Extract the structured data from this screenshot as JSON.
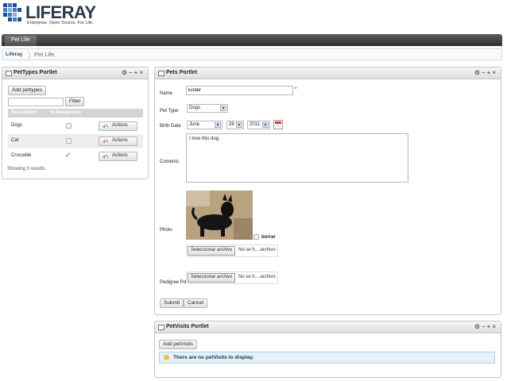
{
  "logo": {
    "wordmark": "LIFERAY",
    "tagline": "Enterprise. Open Source. For Life."
  },
  "nav": {
    "tabs": [
      {
        "label": "Pet Life"
      }
    ]
  },
  "breadcrumb": {
    "items": [
      "Liferay",
      "Pet Life"
    ]
  },
  "pettypes": {
    "title": "PetTypes Portlet",
    "add_label": "Add pettypes",
    "filter_label": "Filter",
    "filter_value": "",
    "columns": [
      "Description",
      "Is Dangerous"
    ],
    "rows": [
      {
        "description": "Dogs",
        "dangerous": false,
        "action": "Actions"
      },
      {
        "description": "Cat",
        "dangerous": false,
        "action": "Actions"
      },
      {
        "description": "Crocodile",
        "dangerous": true,
        "action": "Actions"
      }
    ],
    "results": "Showing 3 results."
  },
  "pets": {
    "title": "Pets Portlet",
    "name_label": "Name",
    "name_value": "Ender",
    "required_mark": "*",
    "pettype_label": "Pet Type",
    "pettype_value": "Dogs",
    "birth_label": "Birth Date",
    "birth_month": "June",
    "birth_day": "26",
    "birth_year": "2011",
    "comments_label": "Coments",
    "comments_value": "I love this dog.",
    "photo_label": "Photo",
    "borrar_label": "borrar",
    "upload_button": "Seleccionar archivo",
    "upload_status": "No se h....archivo",
    "pedigree_label": "Pedigree Pdf",
    "pedigree_button": "Seleccionar archivo",
    "pedigree_status": "No se h....archivo",
    "submit_label": "Submit",
    "cancel_label": "Cancel"
  },
  "petvisits": {
    "title": "PetVisits Portlet",
    "add_label": "Add petVisits",
    "empty_message": "There are no petVisits to display."
  },
  "colors": {
    "navbar": "#3a3a3a",
    "info_bg": "#e5f2fb",
    "check_green": "#1c8a2a"
  }
}
